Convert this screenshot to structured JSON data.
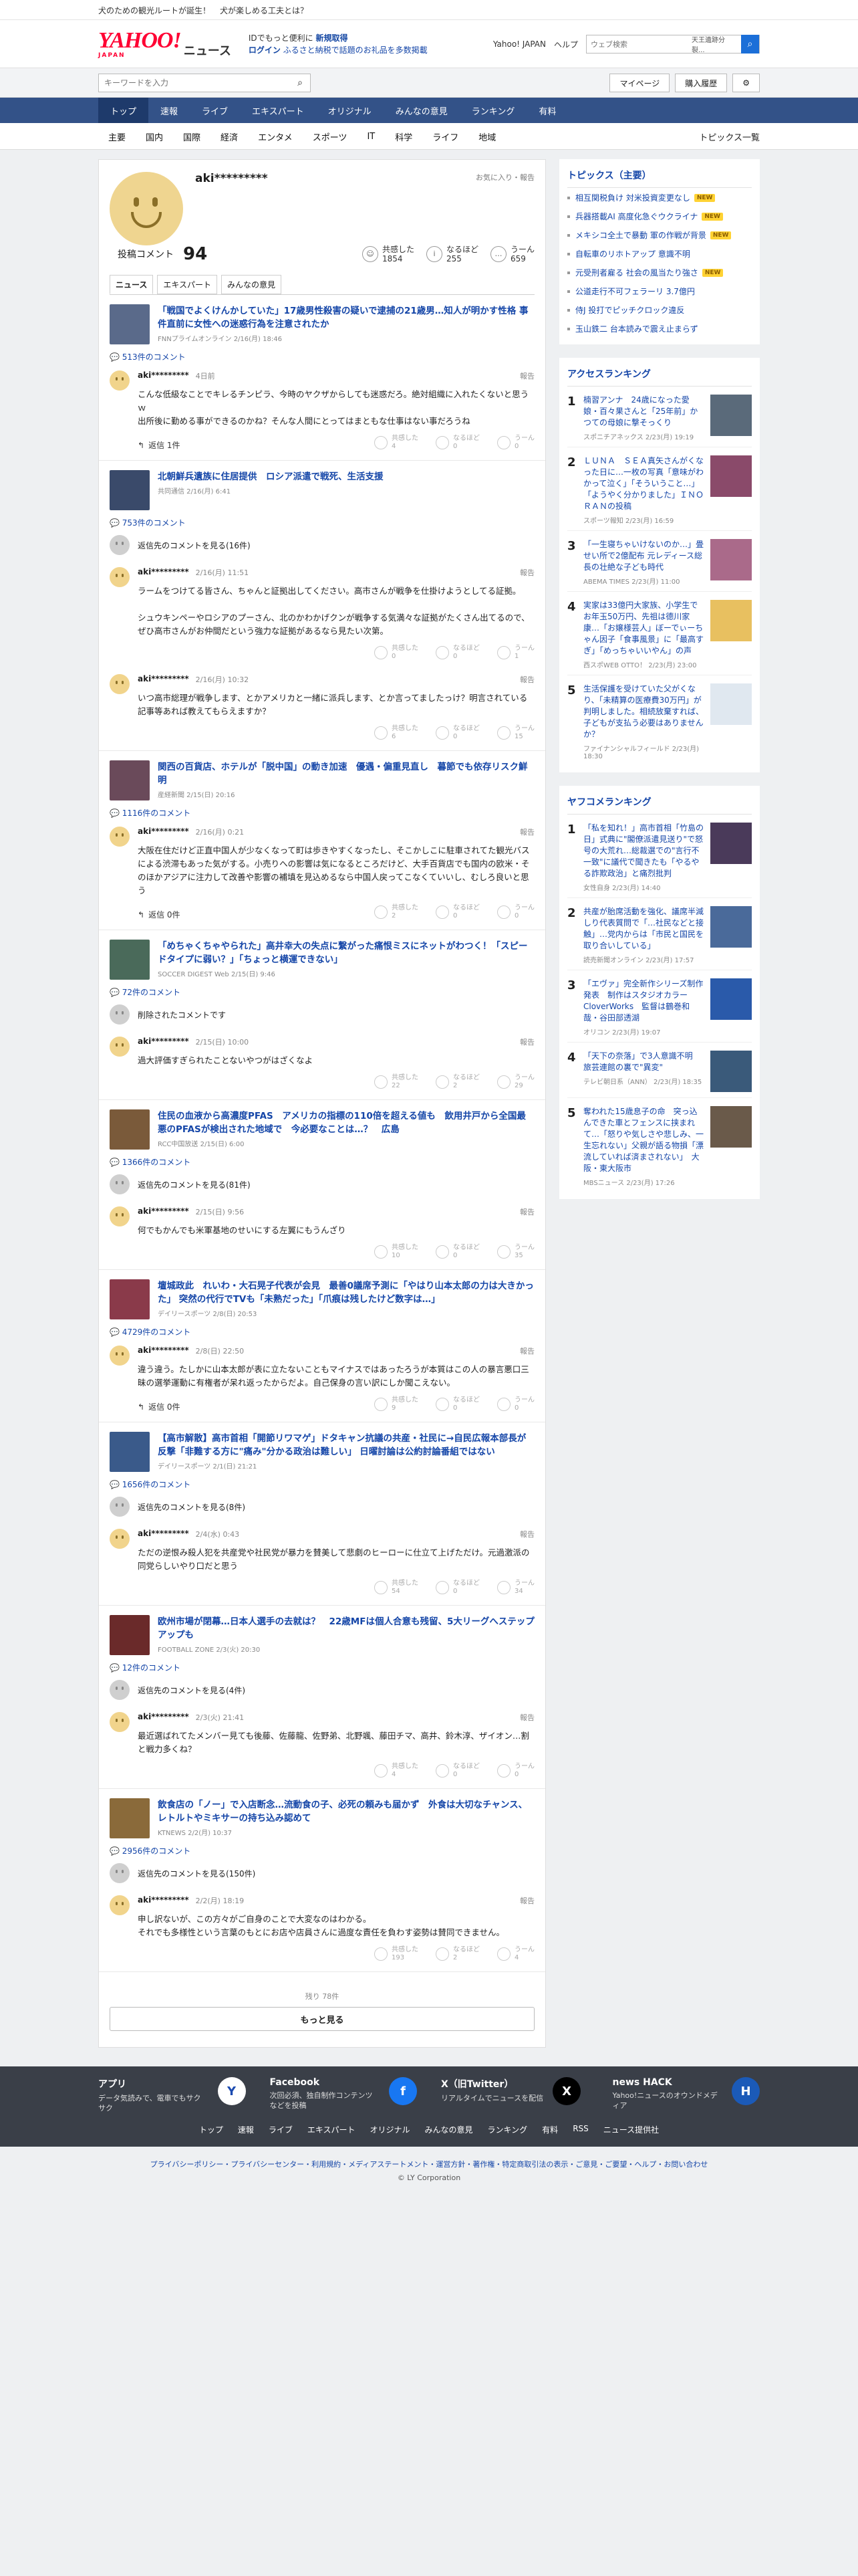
{
  "topbar": {
    "left1": "犬のための観光ルートが誕生！",
    "left2": "犬が楽しめる工夫とは？",
    "right_links": [
      "Yahoo! JAPAN",
      "ヘルプ"
    ]
  },
  "header": {
    "logo": "YAHOO!",
    "logo_sub": "JAPAN",
    "site": "ニュース",
    "promo_line1_a": "IDでもっと便利に",
    "promo_line1_b": "新規取得",
    "promo_line2_a": "ログイン",
    "promo_line2_b": "ふるさと納税で話題のお礼品を多数掲載",
    "search_placeholder": "ウェブ検索",
    "search_value": "天王遺跡分裂..."
  },
  "searchbar": {
    "placeholder": "キーワードを入力",
    "mypage": "マイページ",
    "history": "購入履歴"
  },
  "gnav": [
    "トップ",
    "速報",
    "ライブ",
    "エキスパート",
    "オリジナル",
    "みんなの意見",
    "ランキング",
    "有料"
  ],
  "snav": {
    "items": [
      "主要",
      "国内",
      "国際",
      "経済",
      "エンタメ",
      "スポーツ",
      "IT",
      "科学",
      "ライフ",
      "地域"
    ],
    "right": "トピックス一覧"
  },
  "profile": {
    "name": "aki*********",
    "meta": "お気に入り・報告",
    "comment_label": "投稿コメント",
    "comment_count": "94",
    "reactions": [
      {
        "label": "共感した",
        "count": "1854",
        "icon": "☺"
      },
      {
        "label": "なるほど",
        "count": "255",
        "icon": "i"
      },
      {
        "label": "うーん",
        "count": "659",
        "icon": "…"
      }
    ]
  },
  "tabs": [
    "ニュース",
    "エキスパート",
    "みんなの意見"
  ],
  "articles": [
    {
      "title": "「戦国でよくけんかしていた」17歳男性殺害の疑いで逮捕の21歳男…知人が明かす性格 事件直前に女性への迷惑行為を注意されたか",
      "source": "FNNプライムオンライン 2/16(月) 18:46",
      "ccount": "513件のコメント",
      "thumb": "#5a6a8a",
      "comments": [
        {
          "type": "c",
          "name": "aki*********",
          "date": "4日前",
          "report": "報告",
          "text": "こんな低級なことでキレるチンピラ、今時のヤクザからしても迷惑だろ。絶対組織に入れたくないと思うｗ\n出所後に勤める事ができるのかね？そんな人間にとってはまともな仕事はない事だろうね",
          "reply": "返信 1件",
          "r": [
            {
              "l": "共感した",
              "n": "4"
            },
            {
              "l": "なるほど",
              "n": "0"
            },
            {
              "l": "うーん",
              "n": "0"
            }
          ]
        }
      ]
    },
    {
      "title": "北朝鮮兵遺族に住居提供　ロシア派遣で戦死、生活支援",
      "source": "共同通信 2/16(月) 6:41",
      "ccount": "753件のコメント",
      "thumb": "#3a4a6a",
      "comments": [
        {
          "type": "d",
          "text": "返信先のコメントを見る(16件)"
        },
        {
          "type": "c",
          "name": "aki*********",
          "date": "2/16(月) 11:51",
          "report": "報告",
          "text": "ラームをつけてる皆さん、ちゃんと証拠出してください。高市さんが戦争を仕掛けようとしてる証拠。\n\nシュウキンペーやロシアのプーさん、北のかわかげクンが戦争する気満々な証拠がたくさん出てるので、ぜひ高市さんがお仲間だという強力な証拠があるなら見たい次第。",
          "reply": "",
          "r": [
            {
              "l": "共感した",
              "n": "0"
            },
            {
              "l": "なるほど",
              "n": "0"
            },
            {
              "l": "うーん",
              "n": "1"
            }
          ]
        },
        {
          "type": "c",
          "name": "aki*********",
          "date": "2/16(月) 10:32",
          "report": "報告",
          "text": "いつ高市総理が戦争します、とかアメリカと一緒に派兵します、とか言ってましたっけ？明言されている記事等あれば教えてもらえますか？",
          "reply": "",
          "r": [
            {
              "l": "共感した",
              "n": "6"
            },
            {
              "l": "なるほど",
              "n": "0"
            },
            {
              "l": "うーん",
              "n": "15"
            }
          ]
        }
      ]
    },
    {
      "title": "関西の百貨店、ホテルが「脱中国」の動き加速　優遇・偏重見直し　暮節でも依存リスク鮮明",
      "source": "産経新聞 2/15(日) 20:16",
      "ccount": "1116件のコメント",
      "thumb": "#6a4a5a",
      "comments": [
        {
          "type": "c",
          "name": "aki*********",
          "date": "2/16(月) 0:21",
          "report": "報告",
          "text": "大阪在住だけど正直中国人が少なくなって町は歩きやすくなったし、そこかしこに駐車されてた観光バスによる渋滞もあった気がする。小売りへの影響は気になるところだけど、大手百貨店でも国内の欧米・そのほかアジアに注力して改善や影響の補填を見込めるなら中国人戻ってこなくていいし、むしろ良いと思う",
          "reply": "返信 0件",
          "r": [
            {
              "l": "共感した",
              "n": "2"
            },
            {
              "l": "なるほど",
              "n": "0"
            },
            {
              "l": "うーん",
              "n": "0"
            }
          ]
        }
      ]
    },
    {
      "title": "「めちゃくちゃやられた」高井幸大の失点に繋がった痛恨ミスにネットがわつく！「スピードタイプに弱い？」「ちょっと横運できない」",
      "source": "SOCCER DIGEST Web 2/15(日) 9:46",
      "ccount": "72件のコメント",
      "thumb": "#4a6a5a",
      "comments": [
        {
          "type": "d",
          "text": "削除されたコメントです"
        },
        {
          "type": "c",
          "name": "aki*********",
          "date": "2/15(日) 10:00",
          "report": "報告",
          "text": "過大評価すぎられたことないやつがはざくなよ",
          "reply": "",
          "r": [
            {
              "l": "共感した",
              "n": "22"
            },
            {
              "l": "なるほど",
              "n": "2"
            },
            {
              "l": "うーん",
              "n": "29"
            }
          ]
        }
      ]
    },
    {
      "title": "住民の血液から高濃度PFAS　アメリカの指標の110倍を超える値も　飲用井戸から全国最悪のPFASが検出された地域で　今必要なことは…？　広島",
      "source": "RCC中国放送 2/15(日) 6:00",
      "ccount": "1366件のコメント",
      "thumb": "#7a5a3a",
      "comments": [
        {
          "type": "d",
          "text": "返信先のコメントを見る(81件)"
        },
        {
          "type": "c",
          "name": "aki*********",
          "date": "2/15(日) 9:56",
          "report": "報告",
          "text": "何でもかんでも米軍基地のせいにする左翼にもうんざり",
          "reply": "",
          "r": [
            {
              "l": "共感した",
              "n": "10"
            },
            {
              "l": "なるほど",
              "n": "0"
            },
            {
              "l": "うーん",
              "n": "35"
            }
          ]
        }
      ]
    },
    {
      "title": "壇城政此　れいわ・大石晃子代表が会見　最善0議席予測に「やはり山本太郎の力は大きかった」 突然の代行でTVも「未熟だった」「爪痕は残したけど数字は…」",
      "source": "デイリースポーツ 2/8(日) 20:53",
      "ccount": "4729件のコメント",
      "thumb": "#8a3a4a",
      "comments": [
        {
          "type": "c",
          "name": "aki*********",
          "date": "2/8(日) 22:50",
          "report": "報告",
          "text": "違う違う。たしかに山本太郎が表に立たないこともマイナスではあったろうが本質はこの人の暴言悪口三昧の選挙運動に有権者が呆れ返ったからだよ。自己保身の言い訳にしか聞こえない。",
          "reply": "返信 0件",
          "r": [
            {
              "l": "共感した",
              "n": "9"
            },
            {
              "l": "なるほど",
              "n": "0"
            },
            {
              "l": "うーん",
              "n": "0"
            }
          ]
        }
      ]
    },
    {
      "title": "【高市解散】高市首相「開節リワマゲ」ドタキャン抗議の共産・社民に→自民広報本部長が反撃「非難する方に\"痛み\"分かる政治は難しい」 日曜討論は公約討論番組ではない",
      "source": "デイリースポーツ 2/1(日) 21:21",
      "ccount": "1656件のコメント",
      "thumb": "#3a5a8a",
      "comments": [
        {
          "type": "d",
          "text": "返信先のコメントを見る(8件)"
        },
        {
          "type": "c",
          "name": "aki*********",
          "date": "2/4(水) 0:43",
          "report": "報告",
          "text": "ただの逆恨み殺人犯を共産党や社民党が暴力を賛美して悲劇のヒーローに仕立て上げただけ。元過激派の同党らしいやり口だと思う",
          "reply": "",
          "r": [
            {
              "l": "共感した",
              "n": "54"
            },
            {
              "l": "なるほど",
              "n": "0"
            },
            {
              "l": "うーん",
              "n": "34"
            }
          ]
        }
      ]
    },
    {
      "title": "欧州市場が閉幕…日本人選手の去就は？　22歳MFは個人合意も残留、5大リーグへステップアップも",
      "source": "FOOTBALL ZONE 2/3(火) 20:30",
      "ccount": "12件のコメント",
      "thumb": "#6a2a2a",
      "comments": [
        {
          "type": "d",
          "text": "返信先のコメントを見る(4件)"
        },
        {
          "type": "c",
          "name": "aki*********",
          "date": "2/3(火) 21:41",
          "report": "報告",
          "text": "最近選ばれてたメンバー見ても後藤、佐藤龍、佐野弟、北野颯、藤田チマ、高井、鈴木淳、ザイオン…割と戦力多くね？",
          "reply": "",
          "r": [
            {
              "l": "共感した",
              "n": "4"
            },
            {
              "l": "なるほど",
              "n": "0"
            },
            {
              "l": "うーん",
              "n": "0"
            }
          ]
        }
      ]
    },
    {
      "title": "飲食店の「ノー」で入店断念…流動食の子、必死の頼みも届かず　外食は大切なチャンス、レトルトやミキサーの持ち込み認めて",
      "source": "KTNEWS 2/2(月) 10:37",
      "ccount": "2956件のコメント",
      "thumb": "#8a6a3a",
      "comments": [
        {
          "type": "d",
          "text": "返信先のコメントを見る(150件)"
        },
        {
          "type": "c",
          "name": "aki*********",
          "date": "2/2(月) 18:19",
          "report": "報告",
          "text": "申し訳ないが、この方々がご自身のことで大変なのはわかる。\nそれでも多様性という言葉のもとにお店や店員さんに過度な責任を負わす姿勢は賛同できません。",
          "reply": "",
          "r": [
            {
              "l": "共感した",
              "n": "193"
            },
            {
              "l": "なるほど",
              "n": "2"
            },
            {
              "l": "うーん",
              "n": "4"
            }
          ]
        }
      ]
    }
  ],
  "more": {
    "remaining": "残り 78件",
    "button": "もっと見る"
  },
  "sidebar": {
    "topics_title": "トピックス（主要）",
    "topics": [
      {
        "t": "相互関税負け 対米投資変更なし",
        "n": "NEW"
      },
      {
        "t": "兵器搭載AI 高度化急ぐウクライナ",
        "n": "NEW"
      },
      {
        "t": "メキシコ全土で暴動 軍の作戦が背景",
        "n": "NEW"
      },
      {
        "t": "自転車のリホトアップ 意識不明",
        "n": ""
      },
      {
        "t": "元受刑者雇る 社会の風当たり強さ",
        "n": "NEW"
      },
      {
        "t": "公道走行不可フェラーリ 3.7億円",
        "n": ""
      },
      {
        "t": "侍J 投打でピッチクロック違反",
        "n": ""
      },
      {
        "t": "玉山鉄二 台本読みで震え止まらず",
        "n": ""
      }
    ],
    "access_title": "アクセスランキング",
    "access": [
      {
        "t": "楠習アンナ　24歳になった愛娘・百々果さんと「25年前」かつての母娘に撃そっくり",
        "s": "スポニチアネックス 2/23(月) 19:19",
        "c": "#5a6a7a"
      },
      {
        "t": "ＬＵＮＡ　ＳＥＡ真矢さんがくなった日に…一枚の写真「意味がわかって泣く」「そういうこと…」「ようやく分かりました」ＩＮＯＲＡＮの投稿",
        "s": "スポーツ報知 2/23(月) 16:59",
        "c": "#8a4a6a"
      },
      {
        "t": "「一生寝ちゃいけないのか…」畳せい所で2億配布 元レディース総長の壮絶な子ども時代",
        "s": "ABEMA TIMES 2/23(月) 11:00",
        "c": "#aa6a8a"
      },
      {
        "t": "実家は33億円大家族、小学生でお年玉50万円、先祖は德川家康…「お嬢様芸人」ぼーでぃーちゃん因子「食事風景」に「最高すぎ」「めっちゃいいやん」の声",
        "s": "西スポWEB OTTO！ 2/23(月) 23:00",
        "c": "#e8c060"
      },
      {
        "t": "生活保護を受けていた父がくなり、「未精算の医療費30万円」が判明しました。相続放棄すれば、子どもが支払う必要はありませんか？",
        "s": "ファイナンシャルフィールド 2/23(月) 18:30",
        "c": "#e0e8f0"
      }
    ],
    "yahoo_title": "ヤフコメランキング",
    "yahoo": [
      {
        "t": "「私を知れ！」高市首相「竹島の日」式典に\"閣僚派遣見送り\"で怒号の大荒れ…総裁選での\"言行不一致\"に議代で聞きたも「やるやる詐欺政治」と痛烈批判",
        "s": "女性自身 2/23(月) 14:40",
        "c": "#4a3a5a"
      },
      {
        "t": "共産が胎席活動を強化、議席半減しり代表質問で「…社民などと接触」…党内からは「市民と国民を取り合いしている」",
        "s": "読売新聞オンライン 2/23(月) 17:57",
        "c": "#4a6a9a"
      },
      {
        "t": "「エヴァ」完全新作シリーズ制作発表　制作はスタジオカラー　CloverWorks　監督は鶴巻和哉・谷田部透湖",
        "s": "オリコン 2/23(月) 19:07",
        "c": "#2a5aaa"
      },
      {
        "t": "「天下の奈落」で3人意識不明　旅芸連館の裏で\"異変\"",
        "s": "テレビ朝日系（ANN） 2/23(月) 18:35",
        "c": "#3a5a7a"
      },
      {
        "t": "奪われた15歳息子の命　突っ込んできた車とフェンスに挟まれて…「怒りや気しさや悲しみ、一生忘れない」父親が語る物損「漂流していれば済まされない」　大阪・東大阪市",
        "s": "MBSニュース 2/23(月) 17:26",
        "c": "#6a5a4a"
      }
    ]
  },
  "footer": {
    "apps": [
      {
        "b": "アプリ",
        "d": "データ気読みで、電車でもサクサク",
        "icon": "Y",
        "c": "#ffffff",
        "fc": "#1b4ab0"
      },
      {
        "b": "Facebook",
        "d": "次回必須、独自制作コンテンツなどを投稿",
        "icon": "f",
        "c": "#1877f2",
        "fc": "#ffffff"
      },
      {
        "b": "X（旧Twitter）",
        "d": "リアルタイムでニュースを配信",
        "icon": "X",
        "c": "#000000",
        "fc": "#ffffff"
      },
      {
        "b": "news HACK",
        "d": "Yahoo!ニュースのオウンドメディア",
        "icon": "H",
        "c": "#1b5ab8",
        "fc": "#ffffff"
      }
    ],
    "links": [
      "トップ",
      "速報",
      "ライブ",
      "エキスパート",
      "オリジナル",
      "みんなの意見",
      "ランキング",
      "有料",
      "RSS",
      "ニュース提供社"
    ],
    "legal": "プライバシーポリシー・プライバシーセンター・利用規約・メディアステートメント・運営方針・著作権・特定商取引法の表示・ご意見・ご要望・ヘルプ・お問い合わせ",
    "copy": "© LY Corporation"
  }
}
